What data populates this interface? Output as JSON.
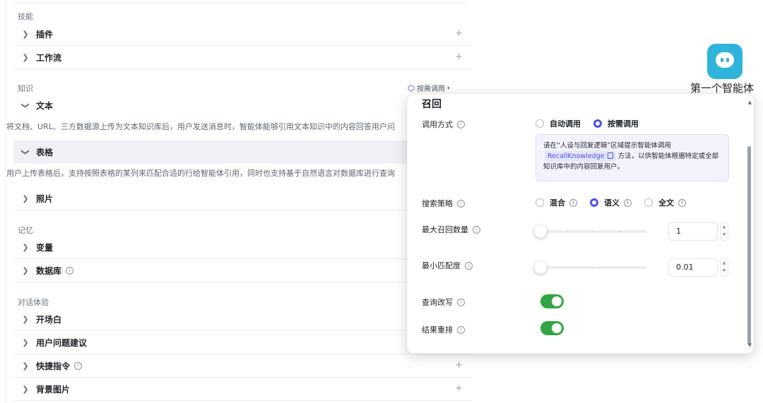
{
  "sections": {
    "skills": "技能",
    "knowledge": "知识",
    "memory": "记忆",
    "dialog": "对话体验"
  },
  "rows": {
    "plugin": "插件",
    "workflow": "工作流",
    "text": "文本",
    "table": "表格",
    "photo": "照片",
    "variable": "变量",
    "database": "数据库",
    "opening": "开场白",
    "suggest": "用户问题建议",
    "shortcut": "快捷指令",
    "background": "背景图片"
  },
  "descriptions": {
    "text": "将文档、URL、三方数据源上传为文本知识库后，用户发送消息时，智能体能够引用文本知识中的内容回答用户问",
    "table": "用户上传表格后，支持按照表格的某列来匹配合适的行给智能体引用，同时也支持基于自然语言对数据库进行查询"
  },
  "call_mode_label": "按需调用",
  "popup": {
    "title": "召回",
    "call_method": {
      "label": "调用方式",
      "options": [
        "自动调用",
        "按需调用"
      ],
      "selected": "按需调用"
    },
    "tip": {
      "pre": "请在“人设与回复逻辑”区域提示智能体调用",
      "code": "RecallKnowledge",
      "post": "方法，以供智能体根据特定或全部知识库中的内容回复用户。"
    },
    "search_strategy": {
      "label": "搜索策略",
      "options": [
        "混合",
        "语义",
        "全文"
      ],
      "selected": "语义"
    },
    "max_recall": {
      "label": "最大召回数量",
      "value": "1"
    },
    "min_match": {
      "label": "最小匹配度",
      "value": "0.01"
    },
    "query_rewrite": {
      "label": "查询改写",
      "on": true
    },
    "result_rerank": {
      "label": "结果重排",
      "on": true
    }
  },
  "bot": {
    "name": "第一个智能体",
    "color": "#2fb4db"
  },
  "colors": {
    "accent": "#4d53e8",
    "toggle_on": "#32a645"
  }
}
